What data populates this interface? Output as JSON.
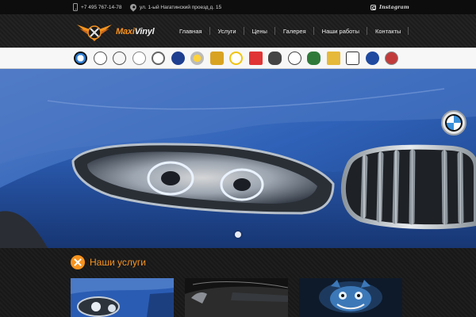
{
  "topbar": {
    "phone": "+7 495 767-14-78",
    "address": "ул. 1-ый Нагатинский проезд д. 15",
    "instagram": "Instagram"
  },
  "header": {
    "logo_part1": "Maxi",
    "logo_part2": "Vinyl"
  },
  "nav": {
    "items": [
      "Главная",
      "Услуги",
      "Цены",
      "Галерея",
      "Наши работы",
      "Контакты"
    ]
  },
  "brands": [
    "BMW",
    "Mercedes-Benz",
    "Audi",
    "Infiniti",
    "Toyota",
    "Subaru",
    "Smart",
    "Porsche",
    "Opel",
    "Mitsubishi",
    "Mini",
    "Mazda",
    "Land Rover",
    "Chevrolet",
    "Honda",
    "Ford",
    "Cadillac"
  ],
  "services": {
    "title": "Наши услуги"
  },
  "colors": {
    "accent": "#f7931e",
    "hero_blue": "#2f62b8"
  }
}
